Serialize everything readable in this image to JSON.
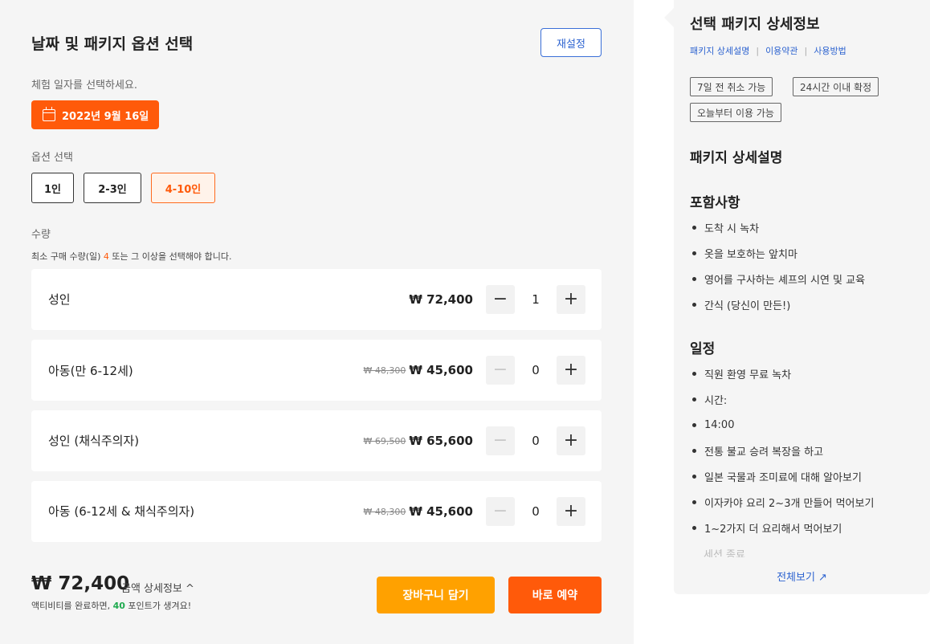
{
  "left": {
    "title": "날짜 및 패키지 옵션 선택",
    "reset_label": "재설정",
    "date_prompt": "체험 일자를 선택하세요.",
    "selected_date": "2022년 9월 16일",
    "option_label": "옵션 선택",
    "options": [
      {
        "label": "1인",
        "selected": false
      },
      {
        "label": "2-3인",
        "selected": false
      },
      {
        "label": "4-10인",
        "selected": true
      }
    ],
    "qty_label": "수량",
    "min_note_prefix": "최소 구매 수량(일) ",
    "min_note_num": "4",
    "min_note_suffix": " 또는 그 이상을 선택해야 합니다.",
    "tickets": [
      {
        "name": "성인",
        "old_price": "",
        "price": "₩ 72,400",
        "qty": "1",
        "minus_disabled": false
      },
      {
        "name": "아동(만 6-12세)",
        "old_price": "₩ 48,300",
        "price": "₩ 45,600",
        "qty": "0",
        "minus_disabled": true
      },
      {
        "name": "성인 (채식주의자)",
        "old_price": "₩ 69,500",
        "price": "₩ 65,600",
        "qty": "0",
        "minus_disabled": true
      },
      {
        "name": "아동 (6-12세 & 채식주의자)",
        "old_price": "₩ 48,300",
        "price": "₩ 45,600",
        "qty": "0",
        "minus_disabled": true
      }
    ],
    "total": "₩ 72,400",
    "total_detail": "금액 상세정보 ^",
    "points_prefix": "액티비티를 완료하면, ",
    "points_num": "40",
    "points_suffix": " 포인트가 생겨요!",
    "cart_label": "장바구니 담기",
    "book_label": "바로 예약"
  },
  "right": {
    "title": "선택 패키지 상세정보",
    "links": [
      "패키지 상세설명",
      "이용약관",
      "사용방법"
    ],
    "tags": [
      "7일 전 취소 가능",
      "24시간 이내 확정",
      "오늘부터 이용 가능"
    ],
    "section_title": "패키지 상세설명",
    "included_title": "포함사항",
    "included": [
      "도착 시 녹차",
      "옷을 보호하는 앞치마",
      "영어를 구사하는 셰프의 시연 및 교육",
      "간식 (당신이 만든!)"
    ],
    "schedule_title": "일정",
    "schedule": [
      "직원 환영 무료 녹차",
      "시간:",
      "14:00",
      "전통 불교 승려 복장을 하고",
      "일본 국물과 조미료에 대해 알아보기",
      "이자카야 요리 2~3개 만들어 먹어보기",
      "1~2가지 더 요리해서 먹어보기"
    ],
    "faded_item": "세션 종료",
    "more_label": "전체보기 ↗"
  }
}
